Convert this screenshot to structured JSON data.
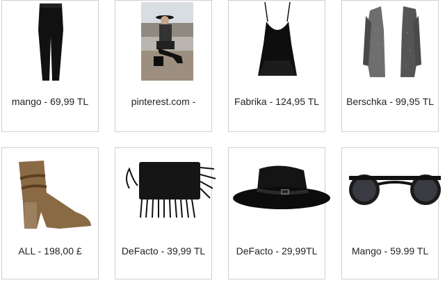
{
  "products": [
    {
      "label": "mango - 69,99 TL",
      "image": "black-jeans"
    },
    {
      "label": "pinterest.com -",
      "image": "street-style-photo"
    },
    {
      "label": "Fabrika - 124,95 TL",
      "image": "black-cami-top"
    },
    {
      "label": "Berschka - 99,95 TL",
      "image": "grey-cardigan"
    },
    {
      "label": "ALL - 198,00 £",
      "image": "tan-ankle-boot"
    },
    {
      "label": "DeFacto - 39,99 TL",
      "image": "fringe-clutch"
    },
    {
      "label": "DeFacto - 29,99TL",
      "image": "black-fedora-hat"
    },
    {
      "label": "Mango - 59.99 TL",
      "image": "round-sunglasses"
    }
  ]
}
